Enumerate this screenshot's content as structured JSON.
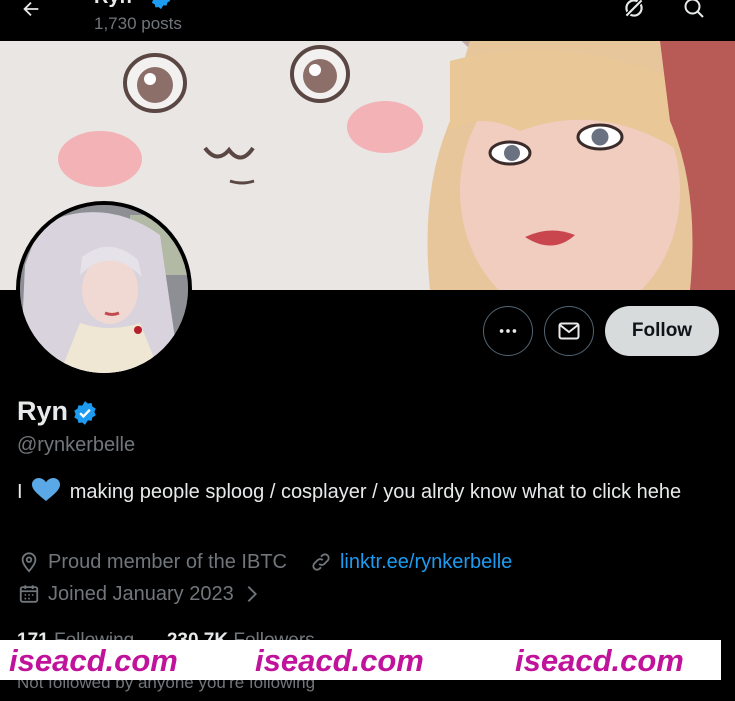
{
  "header": {
    "name": "Ryn",
    "posts": "1,730 posts",
    "back_icon": "arrow-left-icon",
    "grok_icon": "grok-icon",
    "search_icon": "search-icon"
  },
  "profile": {
    "display_name": "Ryn",
    "handle": "@rynkerbelle",
    "verified_color": "#1d9bf0",
    "bio_before": "I",
    "bio_after": "making people sploog / cosplayer / you alrdy know what to click hehe",
    "location": "Proud member of the IBTC",
    "website": "linktr.ee/rynkerbelle",
    "joined": "Joined January 2023"
  },
  "actions": {
    "more_icon": "more-icon",
    "message_icon": "mail-icon",
    "follow_label": "Follow"
  },
  "stats": {
    "following_count": "171",
    "following_label": "Following",
    "followers_count": "230.7K",
    "followers_label": "Followers",
    "not_followed": "Not followed by anyone you're following"
  },
  "watermark": {
    "text1": "iseacd.com",
    "text2": "iseacd.com",
    "text3": "iseacd.com",
    "color": "#c0129a"
  }
}
